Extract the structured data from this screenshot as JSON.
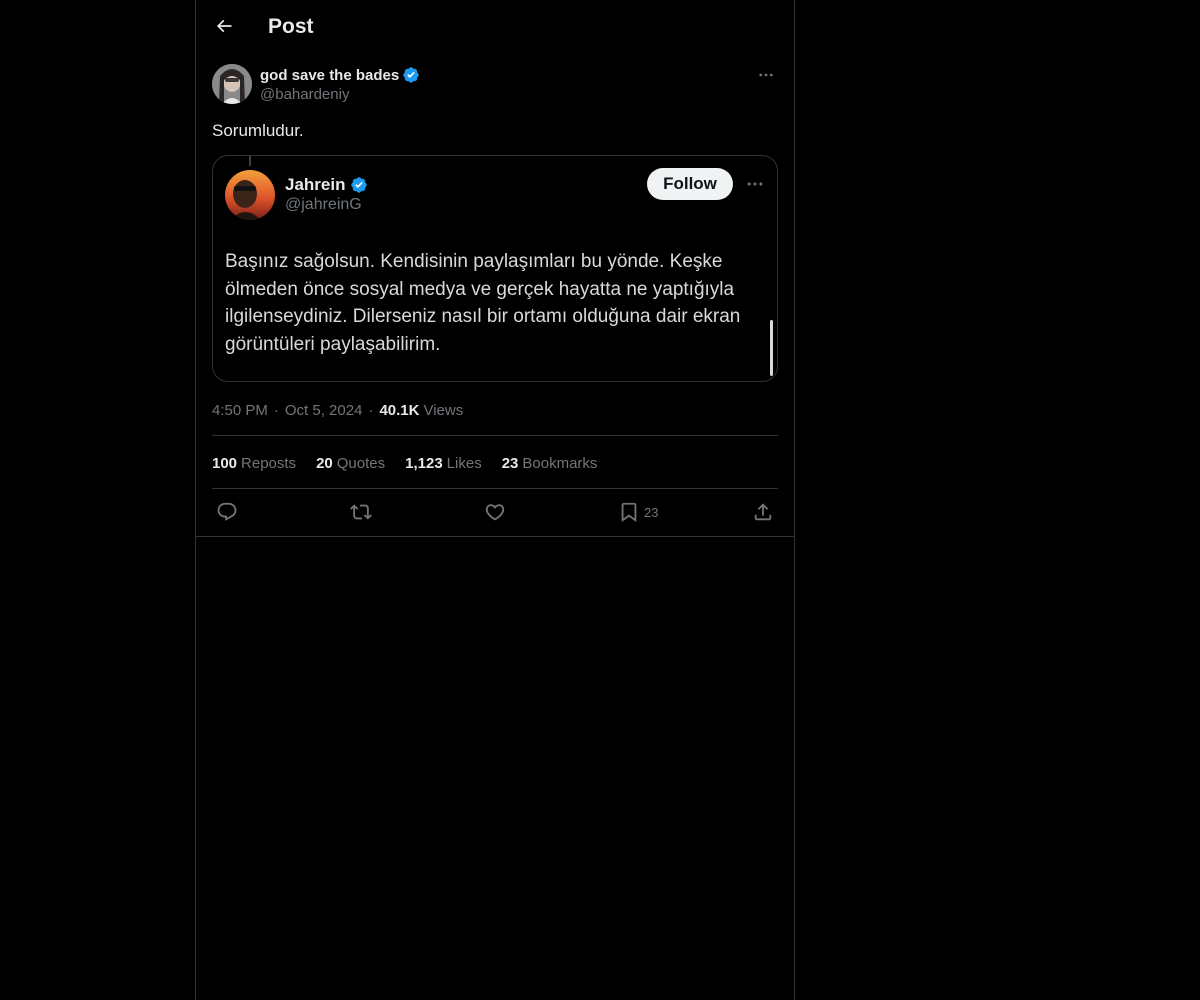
{
  "colors": {
    "background": "#000000",
    "text_primary": "#e7e9ea",
    "text_secondary": "#71767b",
    "border": "#2f3336",
    "verified_blue": "#1d9bf0",
    "follow_button_bg": "#eff3f4"
  },
  "header": {
    "title": "Post",
    "back_icon": "arrow-left-icon"
  },
  "post": {
    "author": {
      "display_name": "god save the bades",
      "handle": "@bahardeniy",
      "verified": true
    },
    "text": "Sorumludur.",
    "embedded_image": {
      "author_name": "Jahrein",
      "author_handle": "@jahreinG",
      "verified": true,
      "follow_label": "Follow",
      "text": "Başınız sağolsun. Kendisinin paylaşımları bu yönde. Keşke ölmeden önce sosyal medya ve gerçek hayatta ne yaptığıyla ilgilenseydiniz. Dilerseniz nasıl bir ortamı olduğuna dair ekran görüntüleri paylaşabilirim."
    },
    "time": "4:50 PM",
    "date": "Oct 5, 2024",
    "separator": "·",
    "views_count": "40.1K",
    "views_label": "Views"
  },
  "stats": {
    "reposts": {
      "count": "100",
      "label": "Reposts"
    },
    "quotes": {
      "count": "20",
      "label": "Quotes"
    },
    "likes": {
      "count": "1,123",
      "label": "Likes"
    },
    "bookmarks": {
      "count": "23",
      "label": "Bookmarks"
    }
  },
  "actions": {
    "reply_icon": "reply-icon",
    "repost_icon": "repost-icon",
    "like_icon": "heart-icon",
    "bookmark_icon": "bookmark-icon",
    "bookmark_count": "23",
    "share_icon": "share-icon"
  }
}
